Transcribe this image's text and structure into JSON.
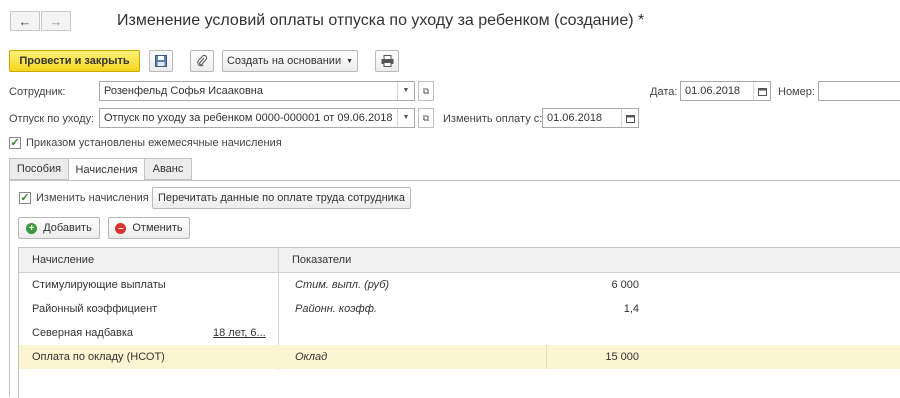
{
  "window": {
    "title": "Изменение условий оплаты отпуска по уходу за ребенком (создание) *"
  },
  "nav": {
    "back_icon": "arrow-left-icon",
    "forward_icon": "arrow-right-icon"
  },
  "toolbar": {
    "post_close_label": "Провести и закрыть",
    "save_icon": "floppy-disk-icon",
    "attach_icon": "paperclip-icon",
    "create_based_label": "Создать на основании",
    "print_icon": "printer-icon"
  },
  "form": {
    "employee_label": "Сотрудник:",
    "employee_value": "Розенфельд Софья Исааковна",
    "date_label": "Дата:",
    "date_value": "01.06.2018",
    "number_label": "Номер:",
    "number_value": "",
    "leave_label": "Отпуск по уходу:",
    "leave_value": "Отпуск по уходу за ребенком 0000-000001 от 09.06.2018",
    "change_from_label": "Изменить оплату с:",
    "change_from_value": "01.06.2018",
    "order_checkbox_label": "Приказом установлены ежемесячные начисления",
    "order_checked": true
  },
  "tabs": [
    {
      "label": "Пособия",
      "active": false
    },
    {
      "label": "Начисления",
      "active": true
    },
    {
      "label": "Аванс",
      "active": false
    }
  ],
  "accruals": {
    "change_checkbox_label": "Изменить начисления",
    "change_checked": true,
    "reread_button_label": "Перечитать данные по оплате труда сотрудника",
    "add_button_label": "Добавить",
    "cancel_button_label": "Отменить",
    "columns": [
      "Начисление",
      "Показатели"
    ],
    "rows": [
      {
        "name": "Стимулирующие выплаты",
        "extra": "",
        "indicator": "Стим. выпл. (руб)",
        "value": "6 000",
        "selected": false
      },
      {
        "name": "Районный коэффициент",
        "extra": "",
        "indicator": "Районн. коэфф.",
        "value": "1,4",
        "selected": false
      },
      {
        "name": "Северная надбавка",
        "extra": "18 лет, 6...",
        "indicator": "",
        "value": "",
        "selected": false
      },
      {
        "name": "Оплата по окладу (НСОТ)",
        "extra": "",
        "indicator": "Оклад",
        "value": "15 000",
        "selected": true
      }
    ]
  },
  "colors": {
    "primary_button": "#f6d51b",
    "selected_row": "#fbf5d2",
    "checkbox_green": "#2d8a2d",
    "cancel_red": "#d9312b",
    "add_green": "#3a9a3a"
  }
}
